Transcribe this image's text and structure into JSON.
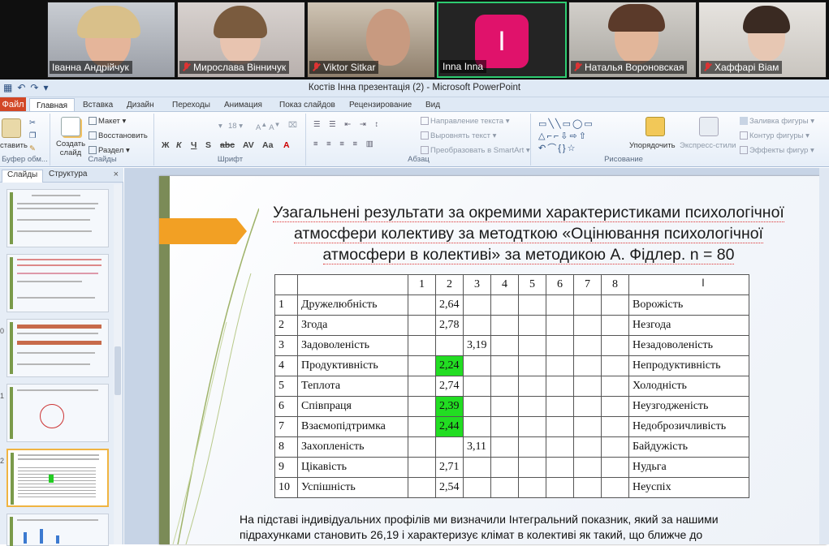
{
  "video": {
    "participants": [
      {
        "name": "Іванна Андрійчук",
        "muted": false
      },
      {
        "name": "Мирослава Вінничук",
        "muted": true
      },
      {
        "name": "Viktor Sitkar",
        "muted": true
      },
      {
        "name": "Inna Inna",
        "muted": false,
        "initial": "I",
        "avatar_color": "#e0126b",
        "active": true
      },
      {
        "name": "Наталья Вороновская",
        "muted": true
      },
      {
        "name": "Хаффарі Віам",
        "muted": true
      }
    ]
  },
  "window": {
    "title": "Костів Інна презентація (2)  -  Microsoft PowerPoint"
  },
  "ribbon": {
    "file_tab": "Файл",
    "tabs": [
      "Главная",
      "Вставка",
      "Дизайн",
      "Переходы",
      "Анимация",
      "Показ слайдов",
      "Рецензирование",
      "Вид"
    ],
    "groups": {
      "clipboard": "Буфер обм...",
      "slides": "Слайды",
      "font": "Шрифт",
      "paragraph": "Абзац",
      "drawing": "Рисование"
    },
    "buttons": {
      "paste": "ставить",
      "create_slide": "Создать слайд",
      "layout": "Макет",
      "reset": "Восстановить",
      "section": "Раздел",
      "font_size": "18",
      "text_direction": "Направление текста",
      "align_text": "Выровнять текст",
      "convert_smartart": "Преобразовать в SmartArt",
      "arrange": "Упорядочить",
      "quick_styles": "Экспресс-стили",
      "shape_fill": "Заливка фигуры",
      "shape_outline": "Контур фигуры",
      "shape_effects": "Эффекты фигур"
    }
  },
  "panel": {
    "tabs": [
      "Слайды",
      "Структура"
    ],
    "close": "×",
    "slide_numbers": [
      "",
      "",
      "0",
      "1",
      "2",
      ""
    ]
  },
  "slide": {
    "title_line1": "Узагальнені результати за окремими характеристиками психологічної",
    "title_line2": "атмосфери колективу за методткою «Оцінювання психологічної",
    "title_line3": "атмосфери в колективі» за методикою А. Фідлер. n = 80",
    "table": {
      "header": [
        "",
        "",
        "1",
        "2",
        "3",
        "4",
        "5",
        "6",
        "7",
        "8",
        ""
      ],
      "rows": [
        {
          "n": "1",
          "pos": "Дружелюбність",
          "c2": "2,64",
          "c3": "",
          "neg": "Ворожість",
          "green": false
        },
        {
          "n": "2",
          "pos": "Згода",
          "c2": "2,78",
          "c3": "",
          "neg": "Незгода",
          "green": false
        },
        {
          "n": "3",
          "pos": "Задоволеність",
          "c2": "",
          "c3": "3,19",
          "neg": "Незадоволеність",
          "green": false
        },
        {
          "n": "4",
          "pos": "Продуктивність",
          "c2": "2,24",
          "c3": "",
          "neg": "Непродуктивність",
          "green": true
        },
        {
          "n": "5",
          "pos": "Теплота",
          "c2": "2,74",
          "c3": "",
          "neg": "Холодність",
          "green": false
        },
        {
          "n": "6",
          "pos": "Співпраця",
          "c2": "2,39",
          "c3": "",
          "neg": "Неузгодженість",
          "green": true
        },
        {
          "n": "7",
          "pos": "Взаємопідтримка",
          "c2": "2,44",
          "c3": "",
          "neg": "Недоброзичливість",
          "green": true
        },
        {
          "n": "8",
          "pos": "Захопленість",
          "c2": "",
          "c3": "3,11",
          "neg": "Байдужість",
          "green": false
        },
        {
          "n": "9",
          "pos": "Цікавість",
          "c2": "2,71",
          "c3": "",
          "neg": "Нудьга",
          "green": false
        },
        {
          "n": "10",
          "pos": "Успішність",
          "c2": "2,54",
          "c3": "",
          "neg": "Неуспіх",
          "green": false
        }
      ]
    },
    "body_line1": "На підставі індивідуальних профілів ми визначили Інтегральний показник, який за нашими",
    "body_line2": "підрахунками становить 26,19 і характеризує клімат в колективі як такий, що ближче до"
  }
}
